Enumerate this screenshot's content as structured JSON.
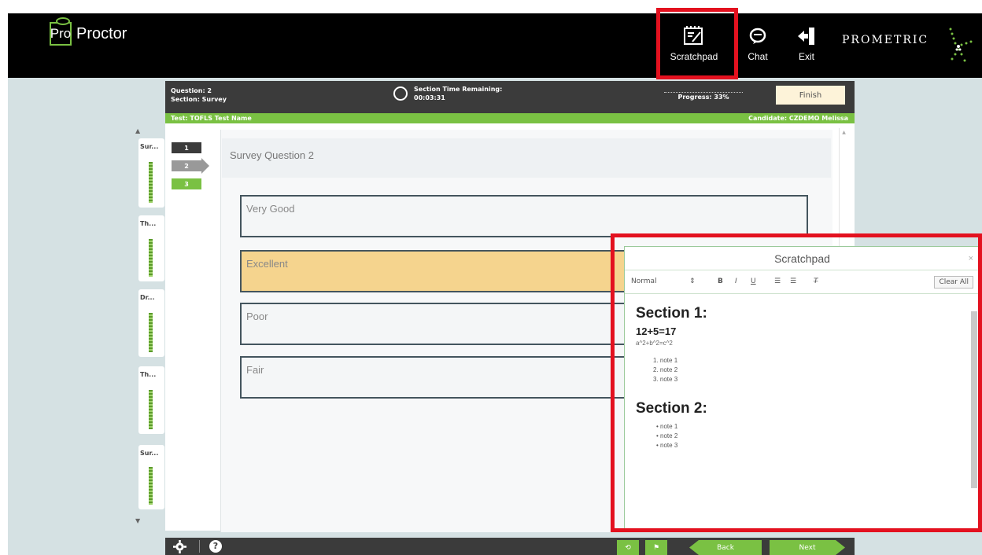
{
  "app": {
    "logo_box": "Pro",
    "logo_text": "Proctor",
    "brand": "PROMETRIC"
  },
  "topnav": {
    "scratchpad": "Scratchpad",
    "chat": "Chat",
    "exit": "Exit"
  },
  "header": {
    "question": "Question: 2",
    "section": "Section: Survey",
    "time_label": "Section Time Remaining:",
    "time_value": "00:03:31",
    "progress_label": "Progress: 33%",
    "finish": "Finish",
    "test_name": "Test: TOFLS Test Name",
    "candidate": "Candidate: CZDEMO Melissa"
  },
  "sections": [
    {
      "label": "Sur..."
    },
    {
      "label": "Th..."
    },
    {
      "label": "Dr..."
    },
    {
      "label": "Th..."
    },
    {
      "label": "Sur..."
    }
  ],
  "questions": [
    "1",
    "2",
    "3"
  ],
  "question_title": "Survey Question 2",
  "answers": [
    {
      "label": "Very Good"
    },
    {
      "label": "Excellent"
    },
    {
      "label": "Poor"
    },
    {
      "label": "Fair"
    }
  ],
  "bottom": {
    "back": "Back",
    "next": "Next"
  },
  "scratchpad": {
    "title": "Scratchpad",
    "format": "Normal",
    "clear": "Clear All",
    "section1": "Section 1:",
    "equation": "12+5=17",
    "formula": "a^2+b^2=c^2",
    "notes_ordered": [
      "1. note 1",
      "2. note 2",
      "3. note 3"
    ],
    "section2": "Section 2:",
    "notes_bulleted": [
      "• note 1",
      "• note 2",
      "• note 3"
    ]
  },
  "colors": {
    "accent_green": "#7ac143",
    "highlight_red": "#e3111f",
    "selected_answer": "#f5d48e"
  }
}
